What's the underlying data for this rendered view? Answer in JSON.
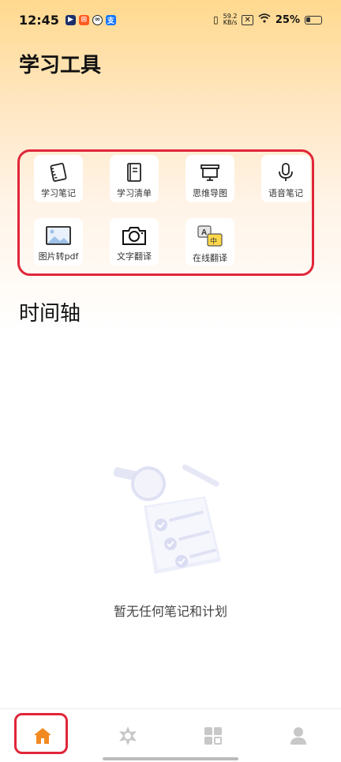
{
  "status_bar": {
    "time": "12:45",
    "net_speed_value": "59.2",
    "net_speed_unit": "KB/s",
    "battery": "25%"
  },
  "page_title": "学习工具",
  "tools": [
    {
      "label": "学习笔记",
      "icon": "notebook-icon"
    },
    {
      "label": "学习清单",
      "icon": "checklist-book-icon"
    },
    {
      "label": "思维导图",
      "icon": "presentation-board-icon"
    },
    {
      "label": "语音笔记",
      "icon": "microphone-icon"
    },
    {
      "label": "图片转pdf",
      "icon": "image-icon"
    },
    {
      "label": "文字翻译",
      "icon": "camera-icon"
    },
    {
      "label": "在线翻译",
      "icon": "translate-icon"
    }
  ],
  "timeline_title": "时间轴",
  "empty_state": {
    "text": "暂无任何笔记和计划",
    "icon": "empty-notes-illustration"
  },
  "tabbar": {
    "tabs": [
      {
        "icon": "home-icon",
        "active": true
      },
      {
        "icon": "discover-icon",
        "active": false
      },
      {
        "icon": "grid-apps-icon",
        "active": false
      },
      {
        "icon": "profile-icon",
        "active": false
      }
    ]
  },
  "colors": {
    "accent": "#f28a22",
    "highlight_border": "#e0263a",
    "inactive_icon": "#c8c8c8"
  }
}
